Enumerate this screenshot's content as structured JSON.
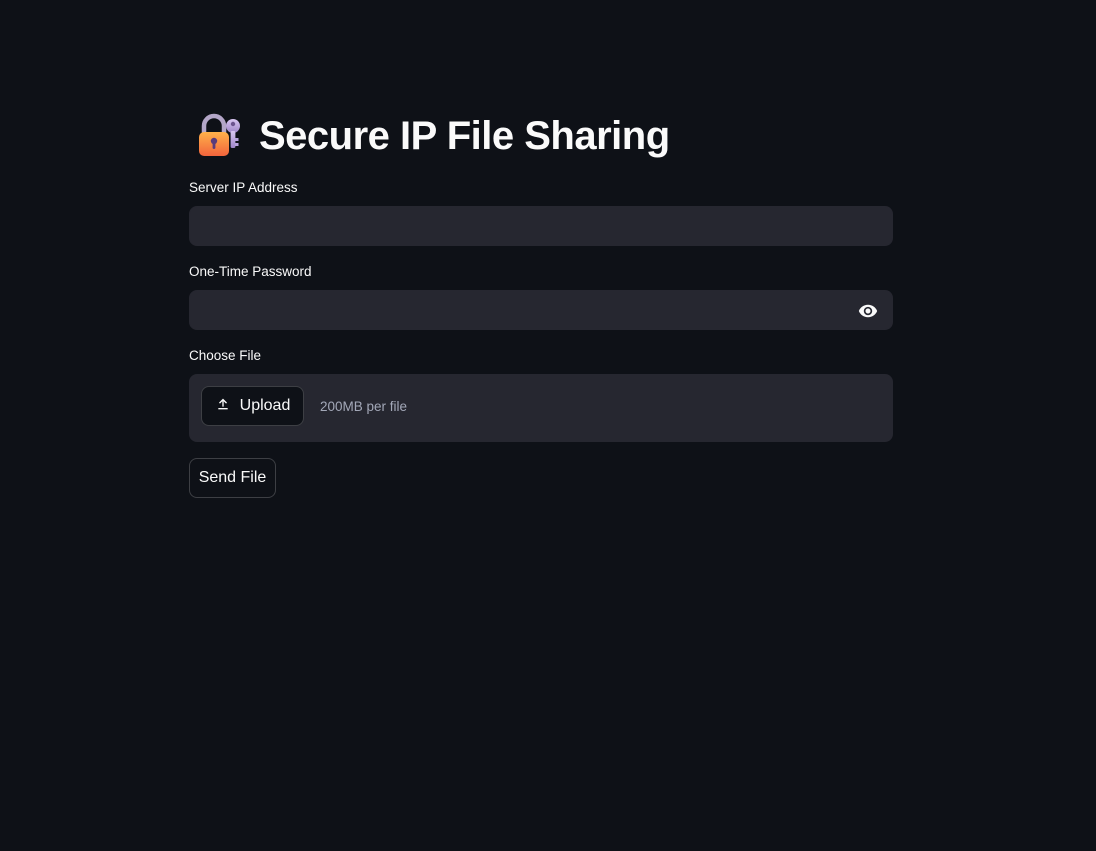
{
  "header": {
    "title": "Secure IP File Sharing",
    "icon": "lock-with-key-icon"
  },
  "form": {
    "server_ip": {
      "label": "Server IP Address",
      "value": "",
      "placeholder": ""
    },
    "password": {
      "label": "One-Time Password",
      "value": "",
      "placeholder": "",
      "toggle_icon": "eye-icon"
    },
    "file": {
      "label": "Choose File",
      "upload_label": "Upload",
      "upload_icon": "upload-icon",
      "limit_text": "200MB per file"
    },
    "send_label": "Send File"
  },
  "colors": {
    "background": "#0e1117",
    "input_background": "#262730",
    "text": "#fafafa",
    "muted_text": "#a3a8b8"
  }
}
